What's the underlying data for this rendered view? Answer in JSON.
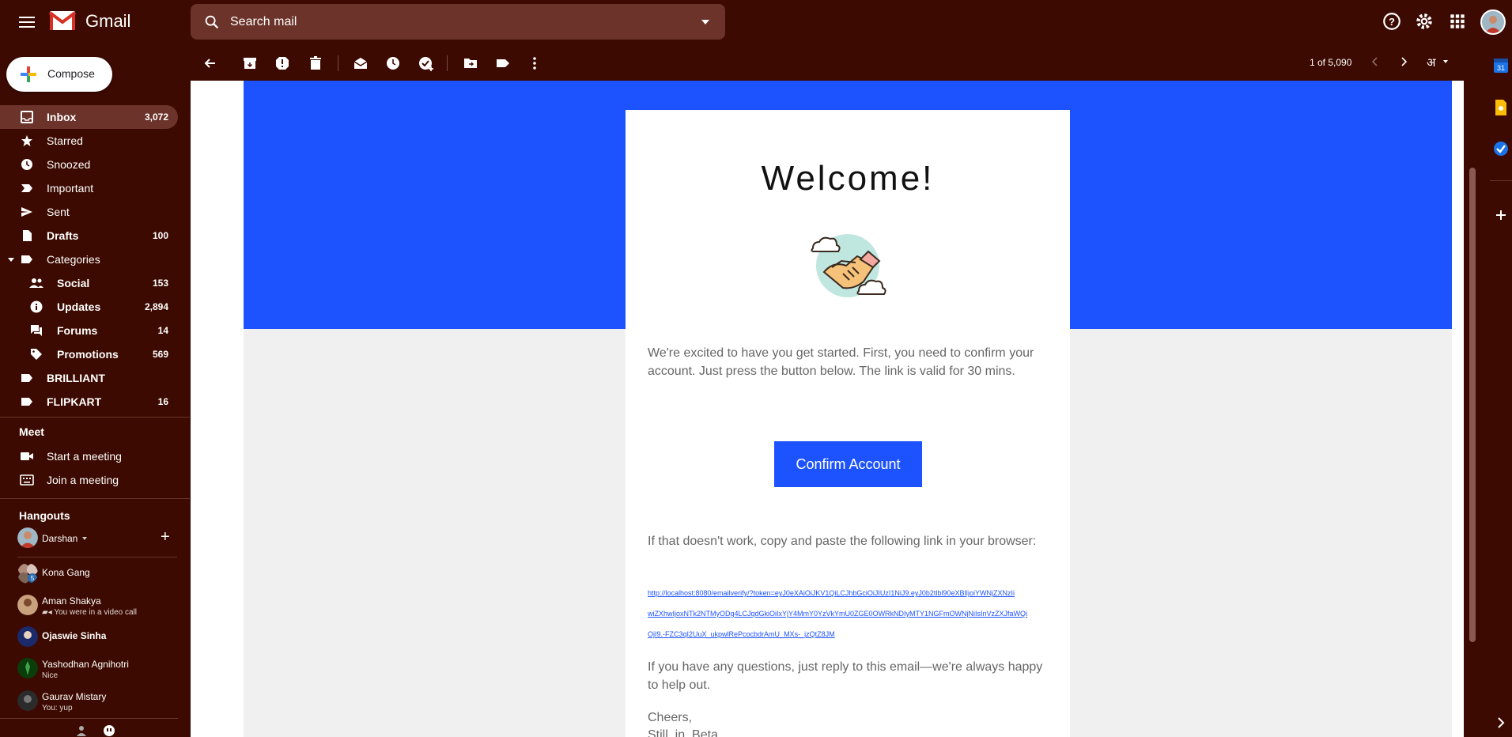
{
  "app": {
    "brand": "Gmail"
  },
  "search": {
    "placeholder": "Search mail"
  },
  "compose": {
    "label": "Compose"
  },
  "nav": [
    {
      "label": "Inbox",
      "count": "3,072",
      "icon": "inbox-icon",
      "bold": true,
      "active": true
    },
    {
      "label": "Starred",
      "count": "",
      "icon": "star-icon"
    },
    {
      "label": "Snoozed",
      "count": "",
      "icon": "clock-icon"
    },
    {
      "label": "Important",
      "count": "",
      "icon": "important-icon"
    },
    {
      "label": "Sent",
      "count": "",
      "icon": "send-icon"
    },
    {
      "label": "Drafts",
      "count": "100",
      "icon": "draft-icon",
      "bold": true
    },
    {
      "label": "Categories",
      "count": "",
      "icon": "label-icon"
    },
    {
      "label": "Social",
      "count": "153",
      "icon": "people-icon",
      "sub": true,
      "bold": true
    },
    {
      "label": "Updates",
      "count": "2,894",
      "icon": "info-icon",
      "sub": true,
      "bold": true
    },
    {
      "label": "Forums",
      "count": "14",
      "icon": "forum-icon",
      "sub": true,
      "bold": true
    },
    {
      "label": "Promotions",
      "count": "569",
      "icon": "tag-icon",
      "sub": true,
      "bold": true
    },
    {
      "label": "BRILLIANT",
      "count": "",
      "icon": "label-icon",
      "bold": true
    },
    {
      "label": "FLIPKART",
      "count": "16",
      "icon": "label-icon",
      "bold": true
    }
  ],
  "meet": {
    "title": "Meet",
    "start": "Start a meeting",
    "join": "Join a meeting"
  },
  "hangouts": {
    "title": "Hangouts",
    "me": "Darshan",
    "contacts": [
      {
        "name": "Kona Gang",
        "status": "",
        "badge": "5"
      },
      {
        "name": "Aman Shakya",
        "status": "You were in a video call"
      },
      {
        "name": "Ojaswie Sinha",
        "status": ""
      },
      {
        "name": "Yashodhan Agnihotri",
        "status": "Nice"
      },
      {
        "name": "Gaurav Mistary",
        "status": "You: yup"
      }
    ]
  },
  "pager": {
    "text": "1 of 5,090",
    "lang": "अ"
  },
  "email": {
    "heading": "Welcome!",
    "intro": "We're excited to have you get started. First, you need to confirm your account. Just press the button below. The link is valid for 30 mins.",
    "button": "Confirm Account",
    "fallback": "If that doesn't work, copy and paste the following link in your browser:",
    "link1": "http://localhost:8080/emailverify/?token=eyJ0eXAiOiJKV1QiLCJhbGciOiJIUzI1NiJ9.eyJ0b2tlbl90eXBlIjoiYWNjZXNzIi",
    "link2": "wiZXhwIjoxNTk2NTMyODg4LCJqdGkiOiIxYjY4MmY0YzVkYmU0ZGE0OWRkNDIyMTY1NGFmOWNjNiIsInVzZXJfaWQi",
    "link3": "OjI9.-FZC3qI2UuX_ukpwlRePcocbdrAmU_MXs-_jzQtZ8JM",
    "questions": "If you have any questions, just reply to this email—we're always happy to help out.",
    "signoff1": "Cheers,",
    "signoff2": "Still_in_Beta"
  },
  "colors": {
    "background": "#3c0a00",
    "accent": "#1d53ff",
    "surface": "#6b3329"
  }
}
